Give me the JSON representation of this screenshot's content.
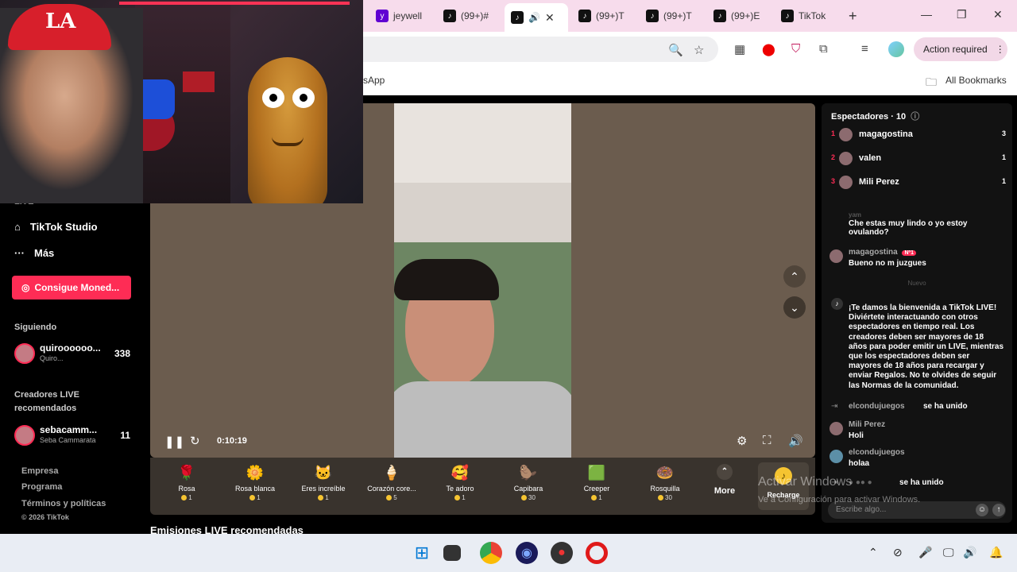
{
  "browser": {
    "tabs": [
      {
        "label": "jeywell",
        "icon": "yahoo-icon"
      },
      {
        "label": "(99+)#",
        "icon": "tiktok-icon"
      },
      {
        "label": "",
        "icon": "tiktok-icon",
        "active": true
      },
      {
        "label": "(99+)T",
        "icon": "tiktok-icon"
      },
      {
        "label": "(99+)T",
        "icon": "tiktok-icon"
      },
      {
        "label": "(99+)E",
        "icon": "tiktok-icon"
      },
      {
        "label": "TikTok",
        "icon": "tiktok-icon"
      }
    ],
    "new_tab": "+",
    "window_controls": {
      "minimize": "—",
      "maximize": "❐",
      "close": "✕"
    },
    "action_required_label": "Action required",
    "bookmarks": {
      "left_partial": "sApp",
      "all_bookmarks": "All Bookmarks"
    }
  },
  "sidebar": {
    "partial_item": "LIVE",
    "items": [
      {
        "label": "TikTok Studio",
        "icon": "home-icon"
      },
      {
        "label": "Más",
        "icon": "more-icon"
      }
    ],
    "coins_button": "Consigue Moned...",
    "following_header": "Siguiendo",
    "following": [
      {
        "name": "quiroooooo...",
        "sub": "Quiro...",
        "count": "338"
      }
    ],
    "recommended_header": "Creadores LIVE recomendados",
    "recommended": [
      {
        "name": "sebacamm...",
        "sub": "Seba Cammarata",
        "count": "11"
      }
    ],
    "footer_links": [
      "Empresa",
      "Programa",
      "Términos y políticas",
      "© 2026 TikTok"
    ]
  },
  "player": {
    "time": "0:10:19",
    "controls": [
      "pause-icon",
      "reload-icon",
      "settings-icon",
      "fullscreen-icon",
      "volume-icon"
    ]
  },
  "gifts": [
    {
      "name": "Rosa",
      "price": "1",
      "icon": "🌹"
    },
    {
      "name": "Rosa blanca",
      "price": "1",
      "icon": "🌼"
    },
    {
      "name": "Eres increíble",
      "price": "1",
      "icon": "🐱"
    },
    {
      "name": "Corazón core...",
      "price": "5",
      "icon": "🍦"
    },
    {
      "name": "Te adoro",
      "price": "1",
      "icon": "🥰"
    },
    {
      "name": "Capibara",
      "price": "30",
      "icon": "🦫"
    },
    {
      "name": "Creeper",
      "price": "1",
      "icon": "🟩"
    },
    {
      "name": "Rosquilla",
      "price": "30",
      "icon": "🍩"
    }
  ],
  "gifts_more": "More",
  "recharge_label": "Recharge",
  "section_title": "Emisiones LIVE recomendadas",
  "chat": {
    "header": "Espectadores · 10",
    "viewers": [
      {
        "rank": "1",
        "name": "magagostina",
        "count": "3"
      },
      {
        "rank": "2",
        "name": "valen",
        "count": "1"
      },
      {
        "rank": "3",
        "name": "Mili Perez",
        "count": "1"
      }
    ],
    "msg1_user": "yam",
    "msg1_text": "Che estas muy lindo o yo estoy ovulando?",
    "msg2_user": "magagostina",
    "msg2_badge": "Nº1",
    "msg2_text": "Bueno no m juzgues",
    "divider_new": "Nuevo",
    "welcome": "¡Te damos la bienvenida a TikTok LIVE! Diviértete interactuando con otros espectadores en tiempo real. Los creadores deben ser mayores de 18 años para poder emitir un LIVE, mientras que los espectadores deben ser mayores de 18 años para recargar y enviar Regalos. No te olvides de seguir las Normas de la comunidad.",
    "join1_user": "elcondujuegos",
    "join1_text": "se ha unido",
    "msg3_user": "Mili Perez",
    "msg3_text": "Holi",
    "msg4_user": "elcondujuegos",
    "msg4_text": "holaa",
    "join2_text": "se ha unido",
    "input_placeholder": "Escribe algo..."
  },
  "watermark": {
    "line1": "Activar Windows",
    "line2": "Ve a Configuración para activar Windows."
  }
}
